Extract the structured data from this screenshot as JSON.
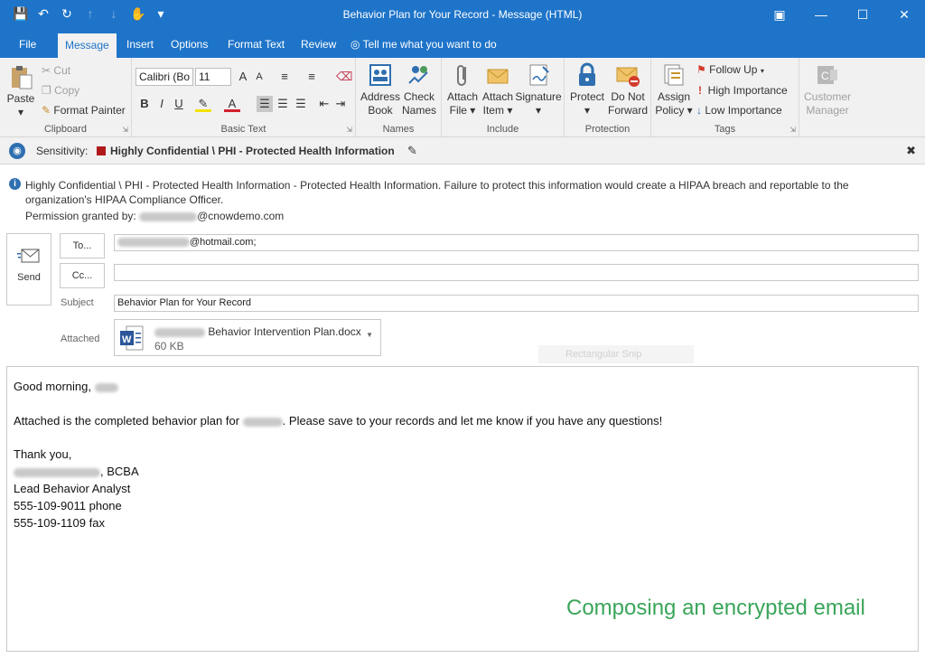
{
  "window": {
    "title": "Behavior Plan for Your Record  -  Message (HTML)"
  },
  "tabs": [
    "File",
    "Message",
    "Insert",
    "Options",
    "Format Text",
    "Review"
  ],
  "tell_me": "Tell me what you want to do",
  "ribbon": {
    "clipboard": {
      "label": "Clipboard",
      "paste": "Paste",
      "cut": "Cut",
      "copy": "Copy",
      "format_painter": "Format Painter"
    },
    "basic_text": {
      "label": "Basic Text",
      "font": "Calibri (Bo",
      "size": "11"
    },
    "names": {
      "label": "Names",
      "address_book": [
        "Address",
        "Book"
      ],
      "check_names": [
        "Check",
        "Names"
      ]
    },
    "include": {
      "label": "Include",
      "attach_file": [
        "Attach",
        "File ▾"
      ],
      "attach_item": [
        "Attach",
        "Item ▾"
      ],
      "signature": "Signature"
    },
    "protection": {
      "label": "Protection",
      "protect": "Protect",
      "do_not_forward": [
        "Do Not",
        "Forward"
      ]
    },
    "tags": {
      "label": "Tags",
      "assign_policy": [
        "Assign",
        "Policy ▾"
      ],
      "follow_up": "Follow Up",
      "high_importance": "High Importance",
      "low_importance": "Low Importance"
    },
    "customer_manager": [
      "Customer",
      "Manager"
    ]
  },
  "sensitivity": {
    "label": "Sensitivity:",
    "value": "Highly Confidential \\ PHI - Protected Health Information",
    "swatch_color": "#b01919"
  },
  "info": {
    "message": "Highly Confidential \\ PHI - Protected Health Information - Protected Health Information.  Failure to protect this information would create a HIPAA breach and reportable to the organization's HIPAA Compliance Officer.",
    "permission_prefix": "Permission granted by:",
    "permission_domain": "@cnowdemo.com"
  },
  "compose": {
    "send": "Send",
    "to_button": "To...",
    "cc_button": "Cc...",
    "to_value": "@hotmail.com;",
    "cc_value": "",
    "subject_label": "Subject",
    "subject_value": "Behavior Plan for Your Record",
    "attached_label": "Attached",
    "attachment_name": "Behavior Intervention Plan.docx",
    "attachment_size": "60 KB",
    "ghost_text": "Rectangular Snip"
  },
  "body": {
    "greeting": "Good morning,",
    "line1_a": "Attached is the completed behavior plan for",
    "line1_b": ".  Please save to your records and let me know if you have any questions!",
    "thanks": "Thank you,",
    "sig_suffix": ", BCBA",
    "title": "Lead Behavior Analyst",
    "phone": "555-109-9011 phone",
    "fax": "555-109-1109 fax"
  },
  "caption": "Composing an encrypted email"
}
